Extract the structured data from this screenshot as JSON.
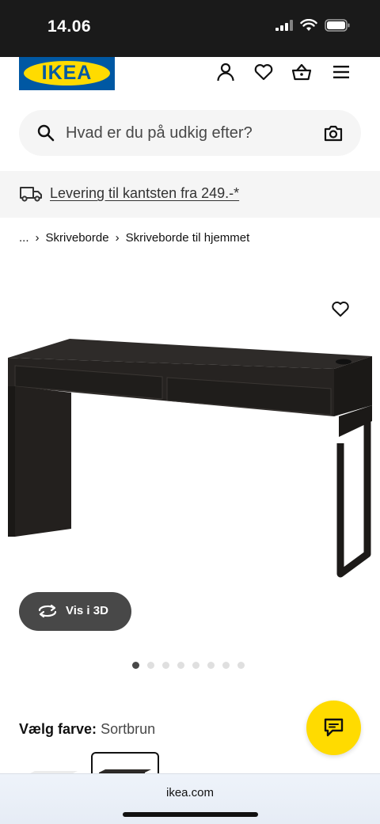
{
  "status_bar": {
    "time": "14.06"
  },
  "header": {
    "logo_text": "IKEA"
  },
  "search": {
    "placeholder": "Hvad er du på udkig efter?"
  },
  "delivery_banner": {
    "text": "Levering til kantsten fra 249.-*"
  },
  "breadcrumb": {
    "items": [
      "...",
      "Skriveborde",
      "Skriveborde til hjemmet"
    ]
  },
  "product_view": {
    "view_3d_label": "Vis i 3D",
    "image_count": 8,
    "active_image": 1
  },
  "color_picker": {
    "label": "Vælg farve:",
    "value": "Sortbrun"
  },
  "browser": {
    "url": "ikea.com"
  },
  "colors": {
    "ikea_blue": "#0058a3",
    "ikea_yellow": "#ffdb00",
    "dark_gray": "#484848",
    "light_gray": "#f5f5f5"
  }
}
